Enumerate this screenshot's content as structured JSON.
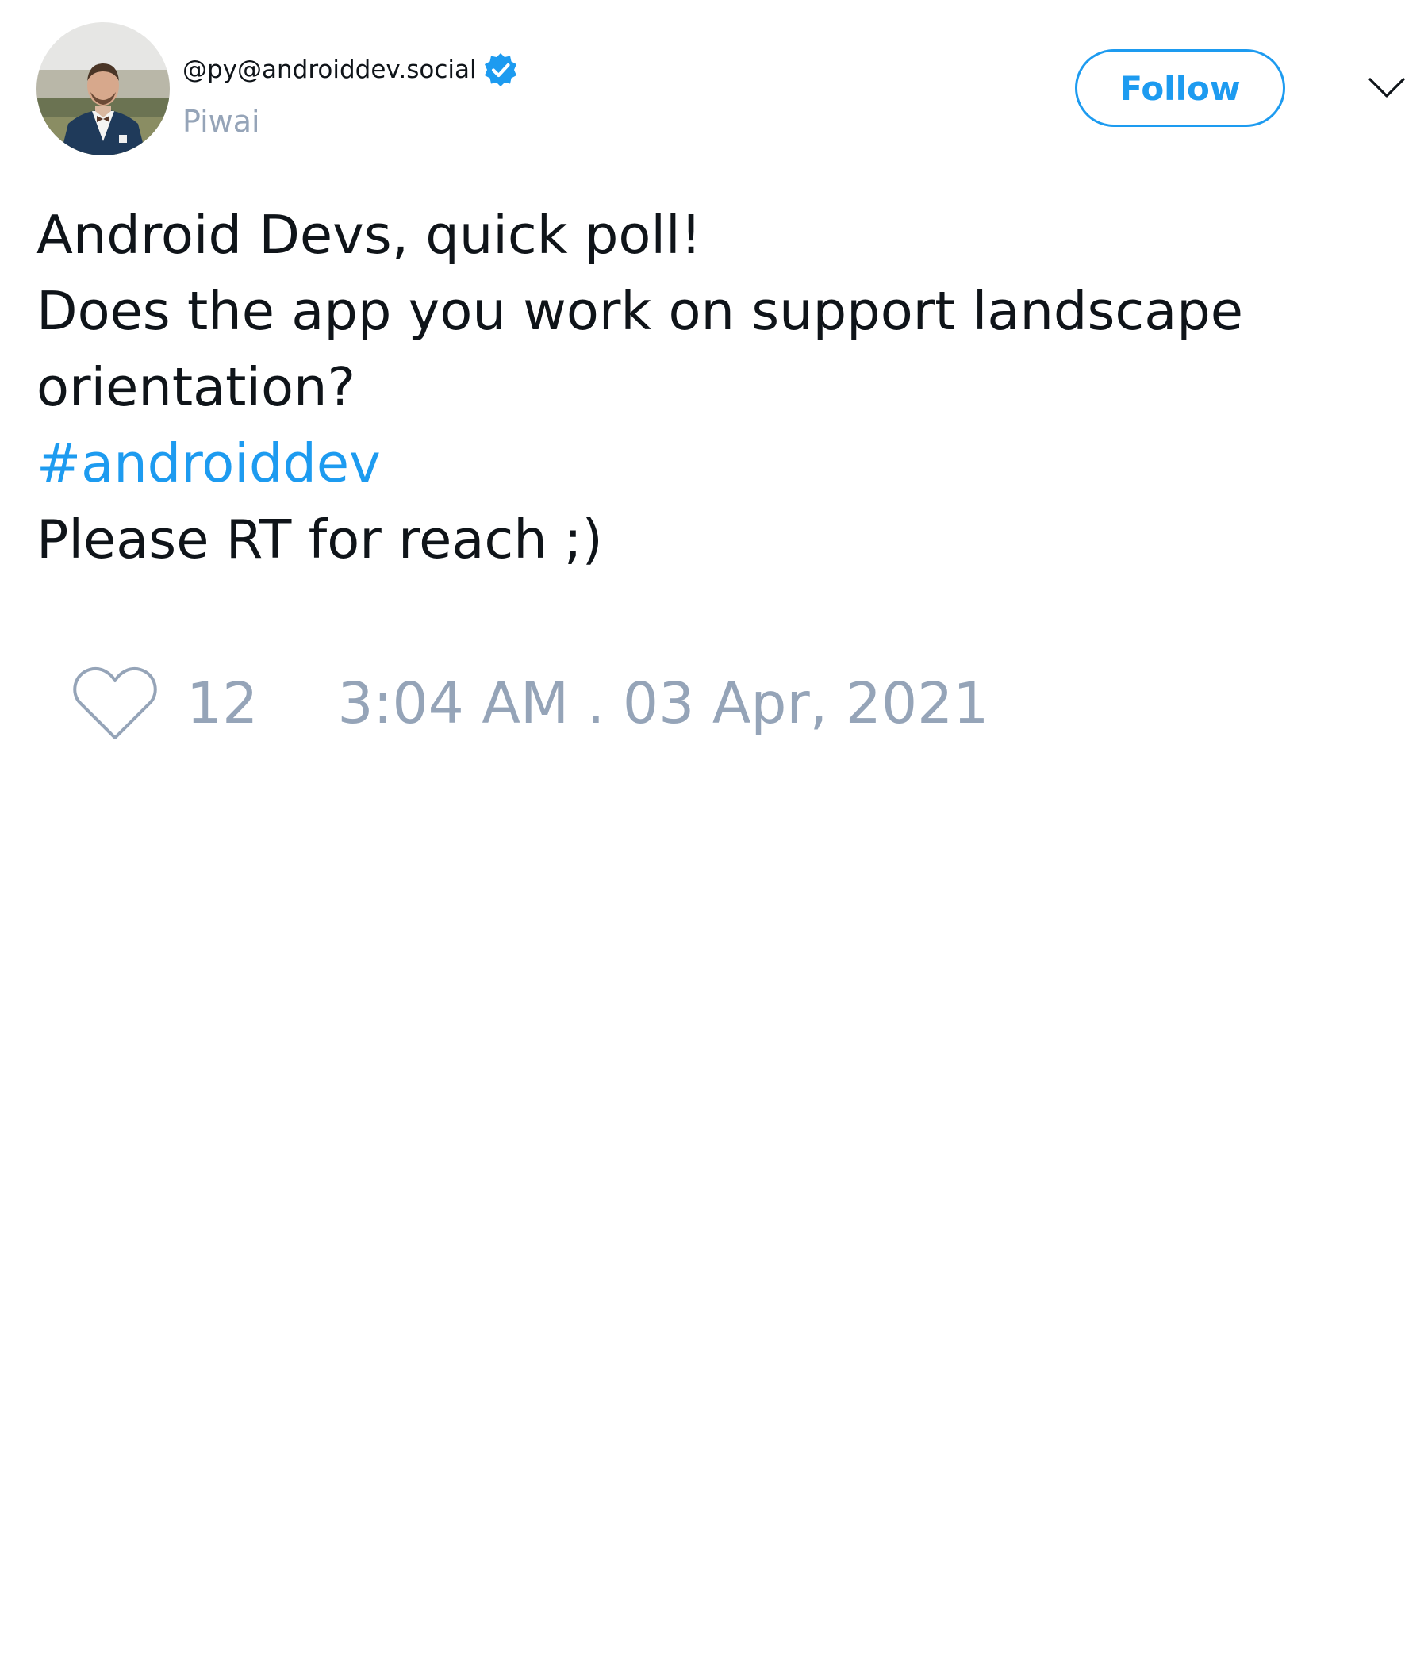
{
  "author": {
    "handle": "@py@androiddev.social",
    "display_name": "Piwai",
    "verified": true,
    "verified_icon": "verified-badge-icon",
    "avatar_icon": "avatar-photo"
  },
  "header": {
    "follow_label": "Follow",
    "more_icon": "chevron-down-icon"
  },
  "tweet": {
    "lines": [
      "Android Devs, quick poll!",
      "Does the app you work on support landscape",
      "orientation?"
    ],
    "hashtag": "#androiddev",
    "closing_line": "Please RT for reach ;)"
  },
  "footer": {
    "like_icon": "heart-icon",
    "like_count": "12",
    "timestamp": "3:04 AM . 03 Apr, 2021"
  },
  "colors": {
    "accent": "#1d9bf0",
    "muted": "#95a4b8",
    "text": "#0f1419"
  }
}
